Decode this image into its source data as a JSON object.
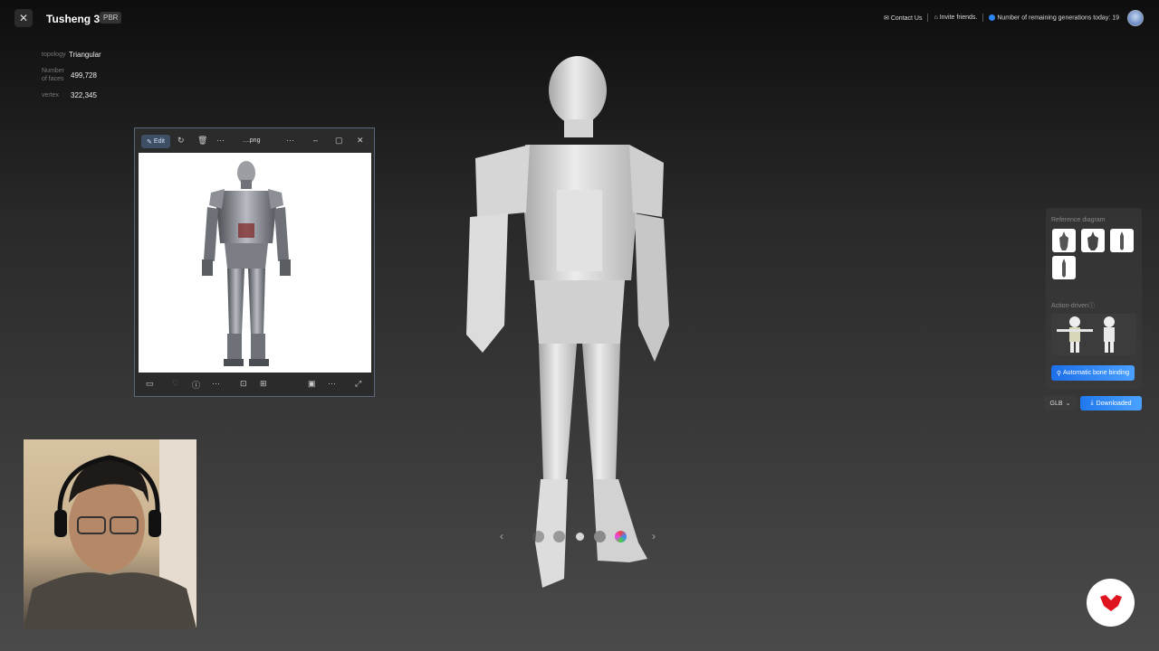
{
  "header": {
    "app_title": "Tusheng 3D",
    "badge": "PBR",
    "contact": "Contact Us",
    "invite": "Invite friends.",
    "remaining": "Number of remaining generations today: 19"
  },
  "stats": [
    {
      "label": "topology",
      "value": "Triangular"
    },
    {
      "label": "Number of faces",
      "value": "499,728"
    },
    {
      "label": "vertex",
      "value": "322,345"
    }
  ],
  "viewer": {
    "edit_label": "Edit",
    "file_name": "....png"
  },
  "panel": {
    "reference_label": "Reference diagram",
    "action_label": "Action-drivenⓘ",
    "bone_button": "Automatic bone binding",
    "format": "GLB",
    "download": "Downloaded"
  },
  "colors": {
    "accent": "#2d86f6",
    "logo": "#e0141e"
  },
  "icons": [
    "close-icon",
    "mail-icon",
    "gift-icon",
    "user-avatar-icon",
    "edit-icon",
    "rotate-icon",
    "delete-icon",
    "more-icon",
    "minimize-icon",
    "maximize-icon",
    "heart-icon",
    "info-icon",
    "crop-icon",
    "expand-icon",
    "chevron-left-icon",
    "chevron-right-icon",
    "bone-icon",
    "download-icon",
    "chevron-down-icon"
  ]
}
